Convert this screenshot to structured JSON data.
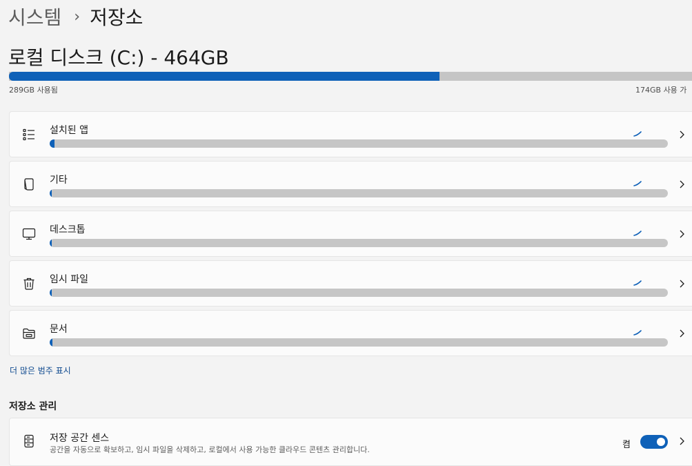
{
  "breadcrumb": {
    "parent": "시스템",
    "separator": "›",
    "current": "저장소"
  },
  "disk": {
    "title": "로컬 디스크 (C:) - 464GB",
    "used_label": "289GB 사용됨",
    "available_label": "174GB 사용 가",
    "used_fraction": 0.63
  },
  "categories": [
    {
      "label": "설치된 앱",
      "icon": "list-icon",
      "fraction": 0.008
    },
    {
      "label": "기타",
      "icon": "document-icon",
      "fraction": 0.003
    },
    {
      "label": "데스크톱",
      "icon": "monitor-icon",
      "fraction": 0.003
    },
    {
      "label": "임시 파일",
      "icon": "trash-icon",
      "fraction": 0.003
    },
    {
      "label": "문서",
      "icon": "folder-icon",
      "fraction": 0.005
    }
  ],
  "more_link": "더 많은 범주 표시",
  "management": {
    "heading": "저장소 관리",
    "storage_sense": {
      "title": "저장 공간 센스",
      "description": "공간을 자동으로 확보하고, 임시 파일을 삭제하고, 로컬에서 사용 가능한 클라우드 콘텐츠 관리합니다.",
      "toggle_label": "켬",
      "enabled": true,
      "icon": "storage-drive-icon"
    }
  },
  "colors": {
    "accent": "#0f61b8",
    "bar_track": "#c6c6c6",
    "background": "#f3f3f3",
    "card": "#fbfbfb"
  }
}
